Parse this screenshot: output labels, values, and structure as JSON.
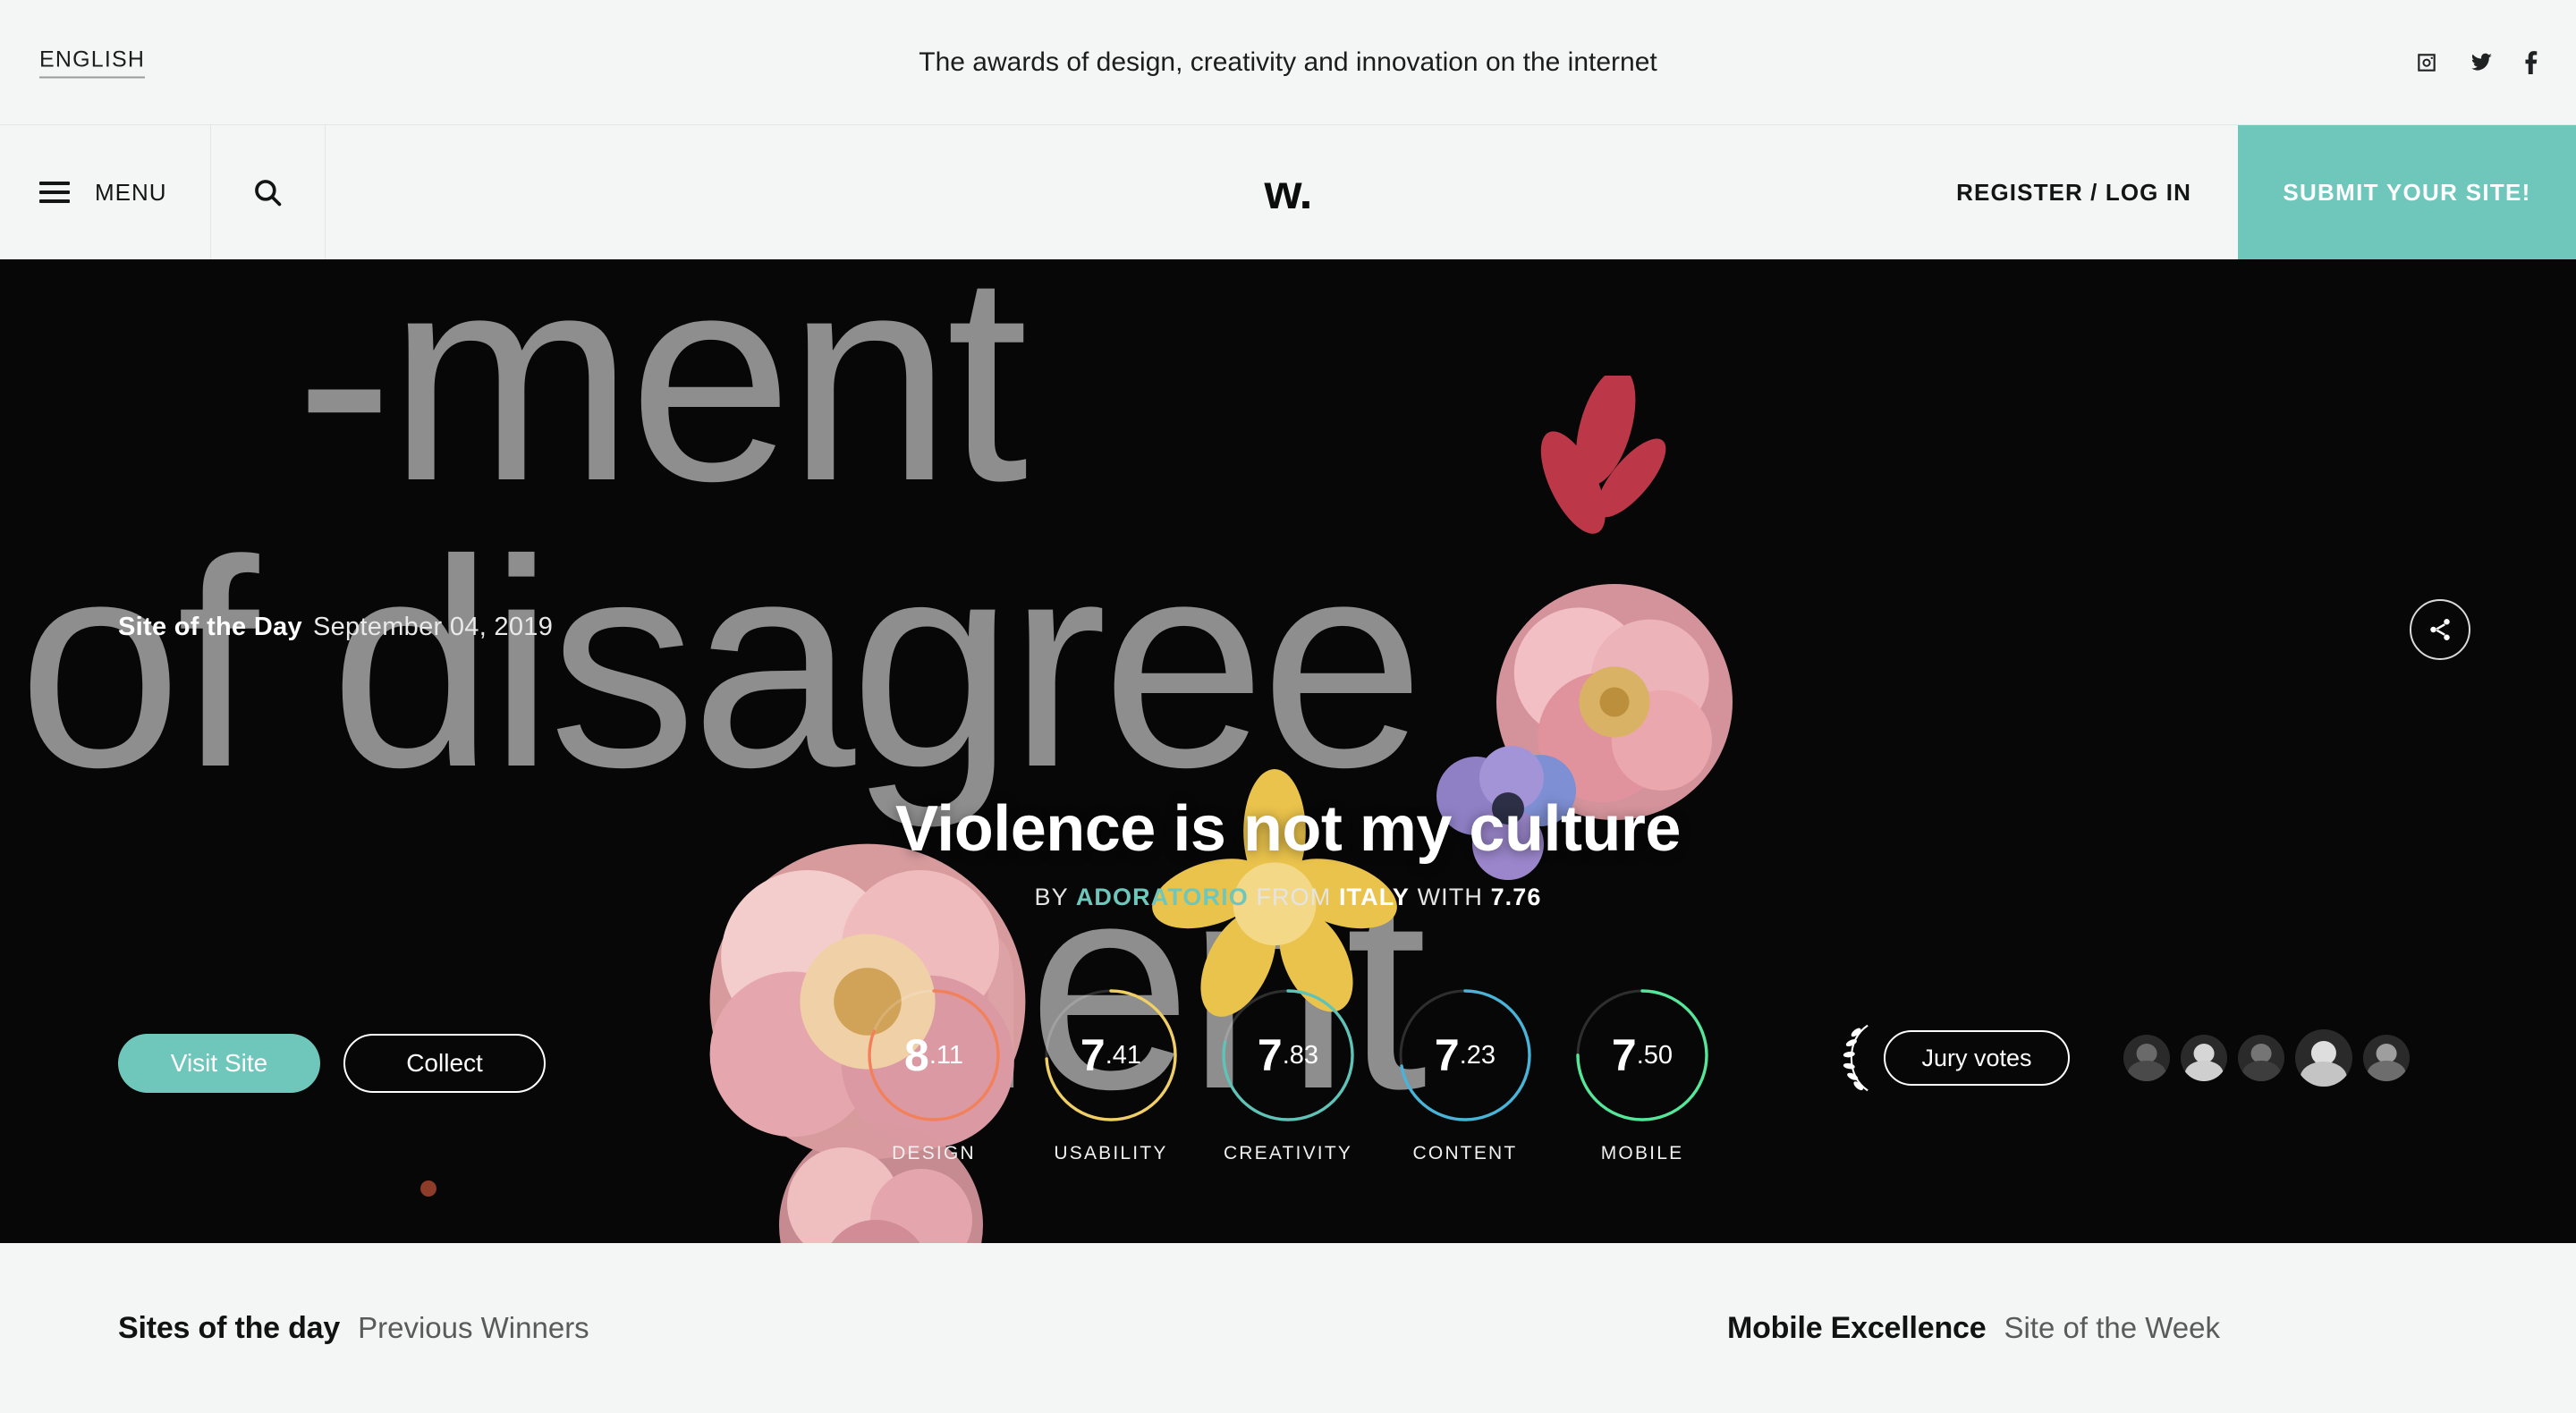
{
  "topbar": {
    "language": "ENGLISH",
    "tagline": "The awards of design, creativity and innovation on the internet",
    "socials": [
      {
        "name": "instagram",
        "label": "Instagram"
      },
      {
        "name": "twitter",
        "label": "Twitter"
      },
      {
        "name": "facebook",
        "label": "Facebook"
      }
    ]
  },
  "nav": {
    "menu_label": "MENU",
    "search_label": "Search",
    "logo": "w.",
    "register_label": "REGISTER / LOG IN",
    "submit_label": "SUBMIT YOUR SITE!"
  },
  "hero": {
    "award_label": "Site of the Day",
    "date": "September 04, 2019",
    "title": "Violence is not my culture",
    "byline": {
      "by": "BY",
      "author": "ADORATORIO",
      "from": "FROM",
      "country": "ITALY",
      "with": "WITH",
      "score": "7.76"
    },
    "background_type": {
      "line1": "-ment",
      "line2": "of disagree",
      "line3": "ment"
    },
    "share_label": "Share",
    "visit_label": "Visit Site",
    "collect_label": "Collect",
    "jury_label": "Jury votes",
    "jurors_count": 5
  },
  "scores": [
    {
      "category": "DESIGN",
      "value": "8.11",
      "int": "8",
      "dec": ".11",
      "percent": 81.1,
      "color": "#f2805a"
    },
    {
      "category": "USABILITY",
      "value": "7.41",
      "int": "7",
      "dec": ".41",
      "percent": 74.1,
      "color": "#f0cf67"
    },
    {
      "category": "CREATIVITY",
      "value": "7.83",
      "int": "7",
      "dec": ".83",
      "percent": 78.3,
      "color": "#5fc3b8"
    },
    {
      "category": "CONTENT",
      "value": "7.23",
      "int": "7",
      "dec": ".23",
      "percent": 72.3,
      "color": "#49b4d8"
    },
    {
      "category": "MOBILE",
      "value": "7.50",
      "int": "7",
      "dec": ".50",
      "percent": 75.0,
      "color": "#55e69a"
    }
  ],
  "bottombar": {
    "left_strong": "Sites of the day",
    "left_soft": "Previous Winners",
    "right_strong": "Mobile Excellence",
    "right_soft": "Site of the Week"
  },
  "colors": {
    "accent_teal": "#6fc7bc",
    "page_bg": "#f4f6f6",
    "hero_bg": "#070707",
    "bg_type": "#8e8e8e"
  }
}
